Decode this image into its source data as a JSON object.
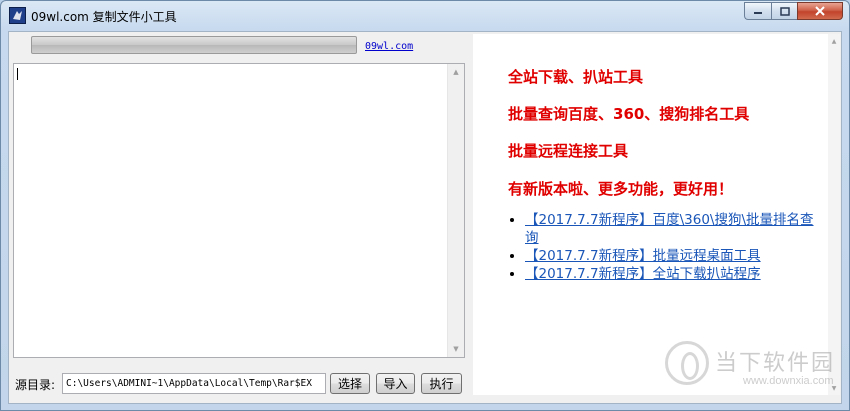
{
  "window": {
    "title": "09wl.com 复制文件小工具",
    "icon": "app-icon",
    "caption_buttons": [
      "minimize-icon",
      "maximize-icon",
      "close-icon"
    ]
  },
  "left": {
    "site_link": "09wl.com",
    "textarea_value": "",
    "source_dir_label": "源目录:",
    "source_dir_value": "C:\\Users\\ADMINI~1\\AppData\\Local\\Temp\\Rar$EX",
    "buttons": {
      "select": "选择",
      "import": "导入",
      "execute": "执行"
    }
  },
  "right": {
    "headlines": [
      "全站下载、扒站工具",
      "批量查询百度、360、搜狗排名工具",
      "批量远程连接工具",
      "有新版本啦、更多功能，更好用！"
    ],
    "links": [
      "【2017.7.7新程序】百度\\360\\搜狗\\批量排名查询",
      "【2017.7.7新程序】批量远程桌面工具",
      "【2017.7.7新程序】全站下载扒站程序"
    ],
    "headline_color": "#e00000",
    "link_color": "#1a56b8"
  },
  "watermark": {
    "text": "当下软件园",
    "url": "www.downxia.com"
  }
}
